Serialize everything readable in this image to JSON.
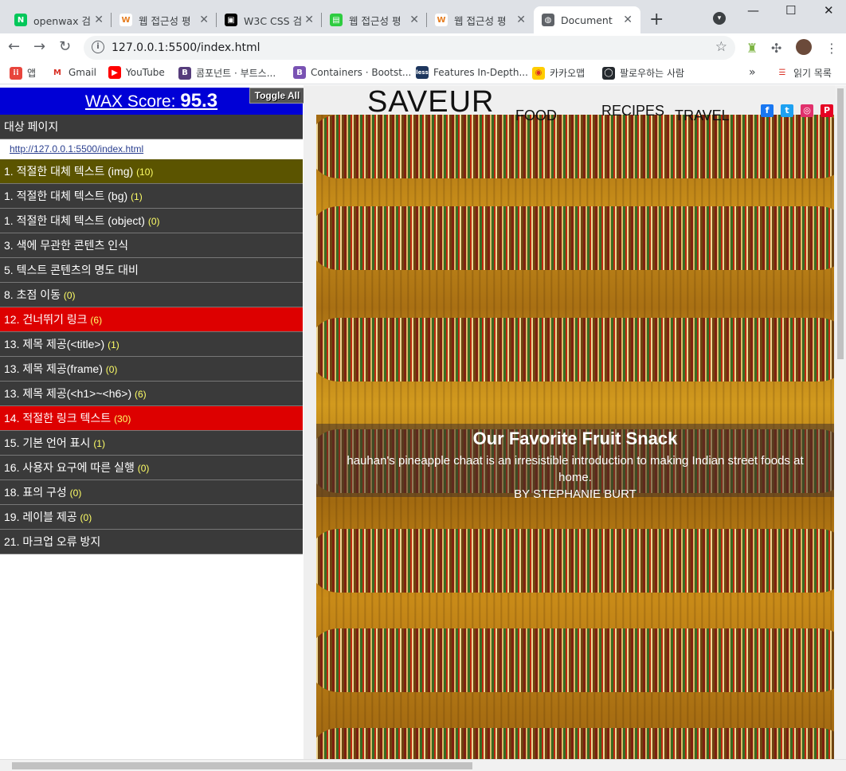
{
  "tabs": [
    {
      "title": "openwax 검",
      "color": "#03c75a",
      "glyph": "N"
    },
    {
      "title": "웹 접근성 평",
      "color": "#ffffff",
      "glyph": "W"
    },
    {
      "title": "W3C CSS 검",
      "color": "#000000",
      "glyph": "▣"
    },
    {
      "title": "웹 접근성 평",
      "color": "#2ecc40",
      "glyph": "▤"
    },
    {
      "title": "웹 접근성 평",
      "color": "#ffffff",
      "glyph": "W"
    },
    {
      "title": "Document",
      "color": "#5f6368",
      "glyph": "◍"
    }
  ],
  "toolbar": {
    "url": "127.0.0.1:5500/index.html"
  },
  "bookmarks": [
    {
      "label": "앱",
      "color": "#e8453c",
      "glyph": "⁞⁞"
    },
    {
      "label": "Gmail",
      "color": "#ffffff",
      "glyph": "M"
    },
    {
      "label": "YouTube",
      "color": "#ff0000",
      "glyph": "▶"
    },
    {
      "label": "콤포넌트 · 부트스...",
      "color": "#563d7c",
      "glyph": "B"
    },
    {
      "label": "Containers · Bootst...",
      "color": "#7952b3",
      "glyph": "B"
    },
    {
      "label": "Features In-Depth...",
      "color": "#1d365d",
      "glyph": "less"
    },
    {
      "label": "카카오맵",
      "color": "#ffcd00",
      "glyph": "◉"
    },
    {
      "label": "팔로우하는 사람",
      "color": "#24292e",
      "glyph": "◯"
    },
    {
      "label": "읽기 목록",
      "color": "#ffffff",
      "glyph": "☰"
    }
  ],
  "wax": {
    "score_label": "WAX Score:",
    "score_value": "95.3",
    "toggle_label": "Toggle All",
    "target_label": "대상 페이지",
    "target_url": "http://127.0.0.1:5500/index.html",
    "rows": [
      {
        "label": "1. 적절한 대체 텍스트 (img)",
        "count": "(10)",
        "status": "olive"
      },
      {
        "label": "1. 적절한 대체 텍스트 (bg)",
        "count": "(1)",
        "status": "gray"
      },
      {
        "label": "1. 적절한 대체 텍스트 (object)",
        "count": "(0)",
        "status": "gray"
      },
      {
        "label": "3. 색에 무관한 콘텐츠 인식",
        "count": "",
        "status": "gray"
      },
      {
        "label": "5. 텍스트 콘텐츠의 명도 대비",
        "count": "",
        "status": "gray"
      },
      {
        "label": "8. 초점 이동",
        "count": "(0)",
        "status": "gray"
      },
      {
        "label": "12. 건너뛰기 링크",
        "count": "(6)",
        "status": "red"
      },
      {
        "label": "13. 제목 제공(<title>)",
        "count": "(1)",
        "status": "gray"
      },
      {
        "label": "13. 제목 제공(frame)",
        "count": "(0)",
        "status": "gray"
      },
      {
        "label": "13. 제목 제공(<h1>~<h6>)",
        "count": "(6)",
        "status": "gray"
      },
      {
        "label": "14. 적절한 링크 텍스트",
        "count": "(30)",
        "status": "red"
      },
      {
        "label": "15. 기본 언어 표시",
        "count": "(1)",
        "status": "gray"
      },
      {
        "label": "16. 사용자 요구에 따른 실행",
        "count": "(0)",
        "status": "gray"
      },
      {
        "label": "18. 표의 구성",
        "count": "(0)",
        "status": "gray"
      },
      {
        "label": "19. 레이블 제공",
        "count": "(0)",
        "status": "gray"
      },
      {
        "label": "21. 마크업 오류 방지",
        "count": "",
        "status": "gray"
      }
    ]
  },
  "site": {
    "logo": "SAVEUR",
    "nav": [
      "FOOD",
      "RECIPES",
      "TRAVEL"
    ],
    "social": [
      {
        "name": "facebook",
        "color": "#1877f2",
        "glyph": "f"
      },
      {
        "name": "twitter",
        "color": "#1da1f2",
        "glyph": "t"
      },
      {
        "name": "instagram",
        "color": "#e1306c",
        "glyph": "◎"
      },
      {
        "name": "pinterest",
        "color": "#e60023",
        "glyph": "P"
      }
    ],
    "hero": {
      "title": "Our Favorite Fruit Snack",
      "description": "hauhan's pineapple chaat is an irresistible introduction to making Indian street foods at",
      "description2": "home.",
      "byline": "BY STEPHANIE BURT"
    }
  }
}
